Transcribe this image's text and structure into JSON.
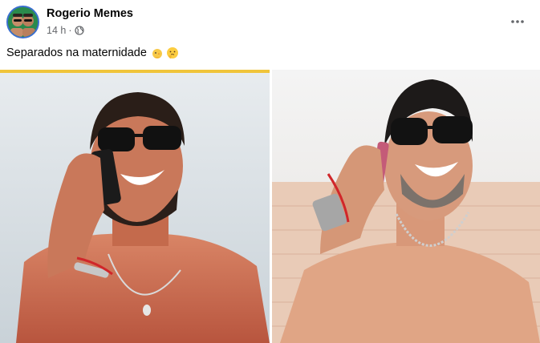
{
  "post": {
    "author": "Rogerio Memes",
    "time": "14 h",
    "separator": "·",
    "privacy_icon": "globe-icon",
    "caption": "Separados na maternidade",
    "caption_emojis": [
      "baby-chick-emoji",
      "thinking-face-emoji"
    ],
    "more_icon": "more-options-icon"
  },
  "photos": [
    {
      "alt_icon": "photo-left"
    },
    {
      "alt_icon": "photo-right"
    }
  ],
  "colors": {
    "text_primary": "#050505",
    "text_secondary": "#65676b",
    "avatar_bg": "#1f9a55",
    "avatar_ring": "#3b6fd0"
  }
}
